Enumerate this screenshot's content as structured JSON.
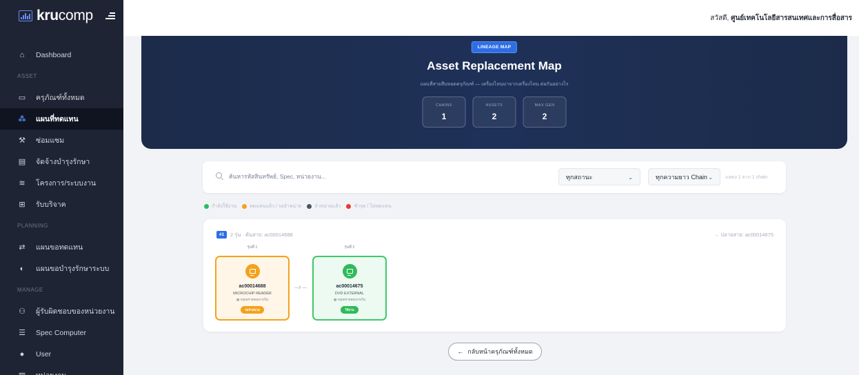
{
  "brand": {
    "name_bold": "kru",
    "name_rest": "comp",
    "logo_icon": "chart-logo-icon",
    "toggle_icon": "menu-toggle-icon"
  },
  "topbar": {
    "greeting": "สวัสดี, ",
    "user_name": "ศูนย์เทคโนโลยีสารสนเทศและการสื่อสาร"
  },
  "sidebar": {
    "items": [
      {
        "label": "Dashboard",
        "icon": "home-icon"
      },
      {
        "section": "ASSET"
      },
      {
        "label": "ครุภัณฑ์ทั้งหมด",
        "icon": "monitor-icon"
      },
      {
        "label": "แผนที่ทดแทน",
        "icon": "sitemap-icon",
        "active": true
      },
      {
        "label": "ซ่อมแซม",
        "icon": "wrench-icon"
      },
      {
        "label": "จัดจ้างบำรุงรักษา",
        "icon": "document-icon"
      },
      {
        "label": "โครงการ/ระบบงาน",
        "icon": "layers-icon"
      },
      {
        "label": "รับบริจาค",
        "icon": "donate-icon"
      },
      {
        "section": "PLANNING"
      },
      {
        "label": "แผนขอทดแทน",
        "icon": "exchange-icon"
      },
      {
        "label": "แผนขอบำรุงรักษาระบบ",
        "icon": "shield-icon"
      },
      {
        "section": "MANAGE"
      },
      {
        "label": "ผู้รับผิดชอบของหน่วยงาน",
        "icon": "users-icon"
      },
      {
        "label": "Spec Computer",
        "icon": "table-icon"
      },
      {
        "label": "User",
        "icon": "user-cog-icon"
      },
      {
        "label": "หน่วยงาน",
        "icon": "building-icon"
      }
    ]
  },
  "hero": {
    "badge": "LINEAGE MAP",
    "title": "Asset Replacement Map",
    "subtitle": "แผนที่สายสืบทอดครุภัณฑ์ — เครื่องไหนมาจากเครื่องไหน ต่อกันอย่างไร",
    "stats": [
      {
        "label": "CHAINS",
        "value": "1"
      },
      {
        "label": "ASSETS",
        "value": "2"
      },
      {
        "label": "MAX GEN",
        "value": "2"
      }
    ]
  },
  "filter": {
    "search_placeholder": "ค้นหารหัสสินทรัพย์, Spec, หน่วยงาน...",
    "status_value": "ทุกสถานะ",
    "length_value": "ทุกความยาว Chain",
    "count_text": "แสดง 1 จาก 1 chain"
  },
  "legend": [
    {
      "color": "#2fbb5b",
      "label": "กำลังใช้งาน"
    },
    {
      "color": "#f3a21d",
      "label": "ทดแทนแล้ว / รอจำหน่าย"
    },
    {
      "color": "#4b5563",
      "label": "จำหน่ายแล้ว"
    },
    {
      "color": "#e53935",
      "label": "ชำรุด / ไม่ทดแทน"
    }
  ],
  "chain": {
    "number": "#1",
    "meta": "2 รุ่น  ·  ต้นสาย: ac00014688",
    "end": "→ ปลายสาย: ac00014675",
    "nodes": [
      {
        "gen": "รุ่นที่ 1",
        "code": "ac00014688",
        "name": "MICROCHIP READER",
        "group": "▦ กลุ่มตรวจสอบภายใน",
        "badge": "รอจำหน่าย",
        "color": "orange"
      },
      {
        "gen": "รุ่นที่ 2",
        "code": "ac00014675",
        "name": "DVD EXTERNAL",
        "group": "▦ กลุ่มตรวจสอบภายใน",
        "badge": "ใช้งาน",
        "color": "green"
      }
    ]
  },
  "back_button": {
    "label": "กลับหน้าครุภัณฑ์ทั้งหมด",
    "icon": "arrow-left-icon"
  }
}
